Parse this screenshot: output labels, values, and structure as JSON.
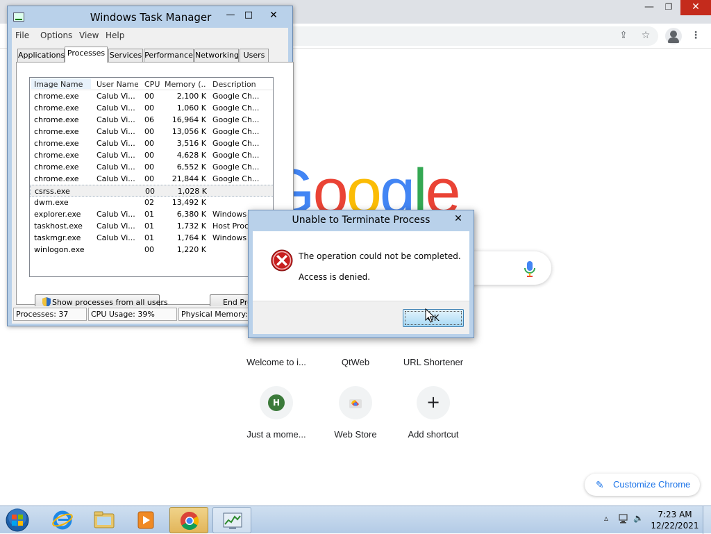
{
  "chrome": {
    "window_controls": {
      "minimize": "—",
      "maximize": "❐",
      "close": "✕"
    },
    "toolbar_icons": [
      "share-icon",
      "star-icon",
      "profile-icon",
      "menu-icon"
    ],
    "star_glyph": "☆",
    "share_glyph": "⇪",
    "menu_glyph": "⋮",
    "logo_letters": [
      {
        "ch": "G",
        "color": "#4285f4"
      },
      {
        "ch": "o",
        "color": "#ea4335"
      },
      {
        "ch": "o",
        "color": "#fbbc05"
      },
      {
        "ch": "g",
        "color": "#4285f4"
      },
      {
        "ch": "l",
        "color": "#34a853"
      },
      {
        "ch": "e",
        "color": "#ea4335"
      }
    ],
    "shortcuts": [
      {
        "label": "Welcome to i..."
      },
      {
        "label": "QtWeb"
      },
      {
        "label": "URL Shortener"
      },
      {
        "label": "Just a mome...",
        "letter": "H"
      },
      {
        "label": "Web Store"
      },
      {
        "label": "Add shortcut",
        "glyph": "+"
      }
    ],
    "customize_label": "Customize Chrome",
    "pencil_glyph": "✎"
  },
  "taskmgr": {
    "title": "Windows Task Manager",
    "controls": {
      "minimize": "—",
      "maximize": "□",
      "close": "✕"
    },
    "menu": [
      "File",
      "Options",
      "View",
      "Help"
    ],
    "tabs": [
      "Applications",
      "Processes",
      "Services",
      "Performance",
      "Networking",
      "Users"
    ],
    "active_tab": "Processes",
    "columns": [
      "Image Name",
      "User Name",
      "CPU",
      "Memory (...",
      "Description"
    ],
    "processes": [
      {
        "name": "chrome.exe",
        "user": "Calub Vi...",
        "cpu": "00",
        "mem": "2,100 K",
        "desc": "Google Ch..."
      },
      {
        "name": "chrome.exe",
        "user": "Calub Vi...",
        "cpu": "00",
        "mem": "1,060 K",
        "desc": "Google Ch..."
      },
      {
        "name": "chrome.exe",
        "user": "Calub Vi...",
        "cpu": "06",
        "mem": "16,964 K",
        "desc": "Google Ch..."
      },
      {
        "name": "chrome.exe",
        "user": "Calub Vi...",
        "cpu": "00",
        "mem": "13,056 K",
        "desc": "Google Ch..."
      },
      {
        "name": "chrome.exe",
        "user": "Calub Vi...",
        "cpu": "00",
        "mem": "3,516 K",
        "desc": "Google Ch..."
      },
      {
        "name": "chrome.exe",
        "user": "Calub Vi...",
        "cpu": "00",
        "mem": "4,628 K",
        "desc": "Google Ch..."
      },
      {
        "name": "chrome.exe",
        "user": "Calub Vi...",
        "cpu": "00",
        "mem": "6,552 K",
        "desc": "Google Ch..."
      },
      {
        "name": "chrome.exe",
        "user": "Calub Vi...",
        "cpu": "00",
        "mem": "21,844 K",
        "desc": "Google Ch..."
      },
      {
        "name": "csrss.exe",
        "user": "",
        "cpu": "00",
        "mem": "1,028 K",
        "desc": "",
        "selected": true
      },
      {
        "name": "dwm.exe",
        "user": "",
        "cpu": "02",
        "mem": "13,492 K",
        "desc": ""
      },
      {
        "name": "explorer.exe",
        "user": "Calub Vi...",
        "cpu": "01",
        "mem": "6,380 K",
        "desc": "Windows ..."
      },
      {
        "name": "taskhost.exe",
        "user": "Calub Vi...",
        "cpu": "01",
        "mem": "1,732 K",
        "desc": "Host Proc..."
      },
      {
        "name": "taskmgr.exe",
        "user": "Calub Vi...",
        "cpu": "01",
        "mem": "1,764 K",
        "desc": "Windows ..."
      },
      {
        "name": "winlogon.exe",
        "user": "",
        "cpu": "00",
        "mem": "1,220 K",
        "desc": ""
      }
    ],
    "show_all_label": "Show processes from all users",
    "end_process_label": "End Proc",
    "status": {
      "processes": "Processes: 37",
      "cpu": "CPU Usage: 39%",
      "memory": "Physical Memory: 2"
    }
  },
  "dialog": {
    "title": "Unable to Terminate Process",
    "close": "✕",
    "message1": "The operation could not be completed.",
    "message2": "Access is denied.",
    "ok_label": "OK"
  },
  "taskbar": {
    "apps": [
      "start-orb",
      "internet-explorer",
      "file-explorer",
      "media-player",
      "google-chrome",
      "task-manager"
    ],
    "active_app": "google-chrome",
    "tray": {
      "up_arrow": "▵",
      "volume": "🔈"
    },
    "time": "7:23 AM",
    "date": "12/22/2021"
  }
}
